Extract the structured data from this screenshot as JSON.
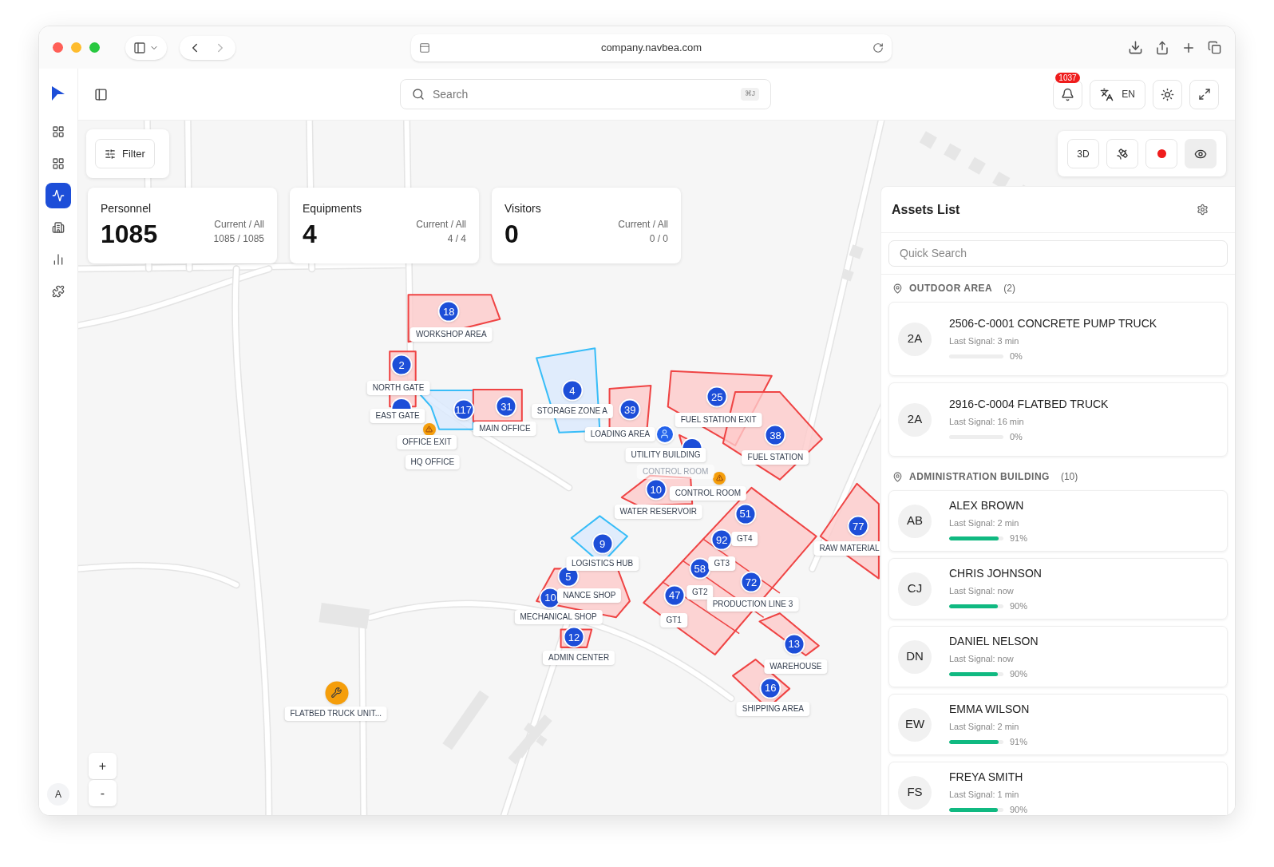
{
  "browser": {
    "url": "company.navbea.com"
  },
  "header": {
    "search": {
      "placeholder": "Search",
      "shortcut": "⌘J"
    },
    "notifications": "1037",
    "language": "EN"
  },
  "nav": [
    {
      "selected": false
    },
    {
      "selected": false
    },
    {
      "selected": true
    },
    {
      "selected": false
    },
    {
      "selected": false
    },
    {
      "selected": false
    }
  ],
  "user_initial": "A",
  "filter": {
    "label": "Filter"
  },
  "stats": [
    {
      "title": "Personnel",
      "value": "1085",
      "caption": "Current / All",
      "ratio": "1085 / 1085"
    },
    {
      "title": "Equipments",
      "value": "4",
      "caption": "Current / All",
      "ratio": "4 / 4"
    },
    {
      "title": "Visitors",
      "value": "0",
      "caption": "Current / All",
      "ratio": "0 / 0"
    }
  ],
  "map_controls": [
    {
      "kind": "text",
      "label": "3D",
      "selected": false
    },
    {
      "kind": "satellite",
      "selected": false
    },
    {
      "kind": "record",
      "selected": false
    },
    {
      "kind": "eye",
      "selected": true
    }
  ],
  "zones": [
    {
      "alarm": true
    },
    {
      "alarm": true
    },
    {
      "alarm": false
    },
    {
      "alarm": true
    },
    {
      "alarm": false
    },
    {
      "alarm": true
    },
    {
      "alarm": true
    },
    {
      "alarm": true
    },
    {
      "alarm": true
    },
    {
      "alarm": true
    },
    {
      "alarm": true
    },
    {
      "alarm": true
    },
    {
      "alarm": false
    },
    {
      "alarm": true
    },
    {
      "alarm": true
    },
    {
      "alarm": true
    },
    {
      "alarm": true
    }
  ],
  "markers": [
    {
      "kind": "count",
      "text": "18"
    },
    {
      "kind": "count",
      "text": "2"
    },
    {
      "kind": "blank"
    },
    {
      "kind": "count",
      "text": "117"
    },
    {
      "kind": "count",
      "text": "31"
    },
    {
      "kind": "alert"
    },
    {
      "kind": "count",
      "text": "4"
    },
    {
      "kind": "count",
      "text": "39"
    },
    {
      "kind": "person"
    },
    {
      "kind": "blank"
    },
    {
      "kind": "count",
      "text": "25"
    },
    {
      "kind": "count",
      "text": "38"
    },
    {
      "kind": "alert"
    },
    {
      "kind": "count",
      "text": "10"
    },
    {
      "kind": "count",
      "text": "51"
    },
    {
      "kind": "count",
      "text": "92"
    },
    {
      "kind": "count",
      "text": "58"
    },
    {
      "kind": "count",
      "text": "72"
    },
    {
      "kind": "count",
      "text": "47"
    },
    {
      "kind": "count",
      "text": "77"
    },
    {
      "kind": "count",
      "text": "9"
    },
    {
      "kind": "count",
      "text": "5"
    },
    {
      "kind": "count",
      "text": "10"
    },
    {
      "kind": "count",
      "text": "12"
    },
    {
      "kind": "count",
      "text": "13"
    },
    {
      "kind": "count",
      "text": "16"
    },
    {
      "kind": "tool"
    }
  ],
  "labels": [
    {
      "text": "WORKSHOP AREA",
      "faded": false
    },
    {
      "text": "NORTH GATE",
      "faded": false
    },
    {
      "text": "EAST GATE",
      "faded": false
    },
    {
      "text": "MAIN OFFICE",
      "faded": false
    },
    {
      "text": "OFFICE EXIT",
      "faded": false
    },
    {
      "text": "HQ OFFICE",
      "faded": false
    },
    {
      "text": "STORAGE ZONE A",
      "faded": false
    },
    {
      "text": "LOADING AREA",
      "faded": false
    },
    {
      "text": "FUEL STATION EXIT",
      "faded": false
    },
    {
      "text": "FUEL STATION",
      "faded": false
    },
    {
      "text": "UTILITY BUILDING",
      "faded": false
    },
    {
      "text": "CONTROL ROOM",
      "faded": true
    },
    {
      "text": "CONTROL ROOM",
      "faded": false
    },
    {
      "text": "WATER RESERVOIR",
      "faded": false
    },
    {
      "text": "GT4",
      "faded": false
    },
    {
      "text": "GT3",
      "faded": false
    },
    {
      "text": "GT2",
      "faded": false
    },
    {
      "text": "GT1",
      "faded": false
    },
    {
      "text": "PRODUCTION LINE 3",
      "faded": false
    },
    {
      "text": "RAW MATERIAL",
      "faded": false
    },
    {
      "text": "LOGISTICS HUB",
      "faded": false
    },
    {
      "text": "NANCE SHOP",
      "faded": false
    },
    {
      "text": "MECHANICAL SHOP",
      "faded": false
    },
    {
      "text": "ADMIN CENTER",
      "faded": false
    },
    {
      "text": "WAREHOUSE",
      "faded": false
    },
    {
      "text": "SHIPPING AREA",
      "faded": false
    },
    {
      "text": "FLATBED TRUCK UNIT...",
      "faded": false
    }
  ],
  "zoom": {
    "in": "+",
    "out": "-"
  },
  "assets": {
    "title": "Assets List",
    "search_placeholder": "Quick Search",
    "groups": [
      {
        "name": "OUTDOOR AREA",
        "count": "(2)",
        "items": [
          {
            "initials": "2A",
            "name": "2506-C-0001 CONCRETE PUMP TRUCK",
            "signal": "Last Signal: 3 min",
            "level": 0,
            "percent": "0%"
          },
          {
            "initials": "2A",
            "name": "2916-C-0004 FLATBED TRUCK",
            "signal": "Last Signal: 16 min",
            "level": 0,
            "percent": "0%"
          }
        ]
      },
      {
        "name": "ADMINISTRATION BUILDING",
        "count": "(10)",
        "items": [
          {
            "initials": "AB",
            "name": "ALEX BROWN",
            "signal": "Last Signal: 2 min",
            "level": 0.91,
            "percent": "91%"
          },
          {
            "initials": "CJ",
            "name": "CHRIS JOHNSON",
            "signal": "Last Signal: now",
            "level": 0.9,
            "percent": "90%"
          },
          {
            "initials": "DN",
            "name": "DANIEL NELSON",
            "signal": "Last Signal: now",
            "level": 0.9,
            "percent": "90%"
          },
          {
            "initials": "EW",
            "name": "EMMA WILSON",
            "signal": "Last Signal: 2 min",
            "level": 0.91,
            "percent": "91%"
          },
          {
            "initials": "FS",
            "name": "FREYA SMITH",
            "signal": "Last Signal: 1 min",
            "level": 0.9,
            "percent": "90%"
          }
        ]
      }
    ]
  }
}
